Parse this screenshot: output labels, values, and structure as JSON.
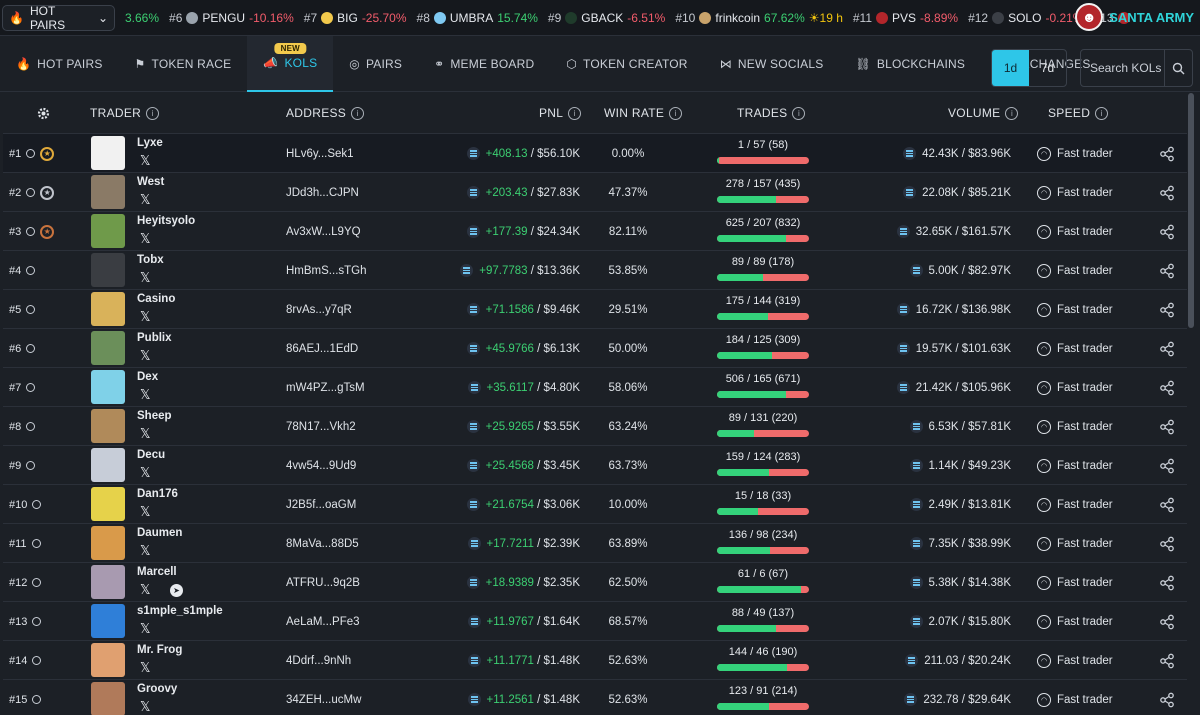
{
  "ticker": {
    "selector_label": "HOT PAIRS",
    "lead_change": "3.66%",
    "items": [
      {
        "rank": "#6",
        "name": "PENGU",
        "change": "-10.16%",
        "dir": "neg",
        "color": "#9aa3ad"
      },
      {
        "rank": "#7",
        "name": "BIG",
        "change": "-25.70%",
        "dir": "neg",
        "color": "#f2c94c"
      },
      {
        "rank": "#8",
        "name": "UMBRA",
        "change": "15.74%",
        "dir": "pos",
        "color": "#7fc9f2"
      },
      {
        "rank": "#9",
        "name": "GBACK",
        "change": "-6.51%",
        "dir": "neg",
        "color": "#1f3b2b"
      },
      {
        "rank": "#10",
        "name": "frinkcoin",
        "change": "67.62%",
        "dir": "pos",
        "color": "#c9a36b",
        "extra": "19 h"
      },
      {
        "rank": "#11",
        "name": "PVS",
        "change": "-8.89%",
        "dir": "neg",
        "color": "#b3262b"
      },
      {
        "rank": "#12",
        "name": "SOLO",
        "change": "-0.21%",
        "dir": "neg",
        "color": "#3b3f46"
      },
      {
        "rank": "#13",
        "name": "",
        "change": "",
        "dir": "neg",
        "color": "#b3262b"
      }
    ],
    "brand": "SANTA ARMY"
  },
  "nav": {
    "tabs": [
      {
        "label": "HOT PAIRS",
        "icon": "flame-icon",
        "glyph": "🔥",
        "active": false
      },
      {
        "label": "TOKEN RACE",
        "icon": "flag-icon",
        "glyph": "⚑",
        "active": false
      },
      {
        "label": "KOLS",
        "icon": "megaphone-icon",
        "glyph": "📣",
        "active": true,
        "badge": "NEW"
      },
      {
        "label": "PAIRS",
        "icon": "pairs-icon",
        "glyph": "◎",
        "active": false
      },
      {
        "label": "MEME BOARD",
        "icon": "binoculars-icon",
        "glyph": "⚭",
        "active": false
      },
      {
        "label": "TOKEN CREATOR",
        "icon": "token-creator-icon",
        "glyph": "⬡",
        "active": false
      },
      {
        "label": "NEW SOCIALS",
        "icon": "share-icon",
        "glyph": "⋈",
        "active": false
      },
      {
        "label": "BLOCKCHAINS",
        "icon": "link-icon",
        "glyph": "⛓",
        "active": false
      },
      {
        "label": "EXCHANGES",
        "icon": "exchange-icon",
        "glyph": "⇄",
        "active": false
      }
    ],
    "period_options": [
      "1d",
      "7d"
    ],
    "period_selected": "1d",
    "search_placeholder": "Search KOLs"
  },
  "table": {
    "headers": {
      "trader": "TRADER",
      "address": "ADDRESS",
      "pnl": "PNL",
      "win_rate": "WIN RATE",
      "trades": "TRADES",
      "volume": "VOLUME",
      "speed": "SPEED"
    },
    "rows": [
      {
        "rank": "#1",
        "medal": "gold",
        "name": "Lyxe",
        "avatar_color": "#f1f1f1",
        "address": "HLv6y...Sek1",
        "pnl_sol": "+408.13",
        "pnl_usd": "/ $56.10K",
        "win_rate": "0.00%",
        "trades": "1 / 57 (58)",
        "buy_frac": 0.02,
        "vol_sol": "42.43K",
        "vol_usd": "/ $83.96K",
        "speed": "Fast trader",
        "telegram": false
      },
      {
        "rank": "#2",
        "medal": "silver",
        "name": "West",
        "avatar_color": "#8a7a66",
        "address": "JDd3h...CJPN",
        "pnl_sol": "+203.43",
        "pnl_usd": "/ $27.83K",
        "win_rate": "47.37%",
        "trades": "278 / 157 (435)",
        "buy_frac": 0.64,
        "vol_sol": "22.08K",
        "vol_usd": "/ $85.21K",
        "speed": "Fast trader",
        "telegram": false
      },
      {
        "rank": "#3",
        "medal": "bronze",
        "name": "Heyitsyolo",
        "avatar_color": "#6f9a4a",
        "address": "Av3xW...L9YQ",
        "pnl_sol": "+177.39",
        "pnl_usd": "/ $24.34K",
        "win_rate": "82.11%",
        "trades": "625 / 207 (832)",
        "buy_frac": 0.75,
        "vol_sol": "32.65K",
        "vol_usd": "/ $161.57K",
        "speed": "Fast trader",
        "telegram": false
      },
      {
        "rank": "#4",
        "medal": "",
        "name": "Tobx",
        "avatar_color": "#3a3d42",
        "address": "HmBmS...sTGh",
        "pnl_sol": "+97.7783",
        "pnl_usd": "/ $13.36K",
        "win_rate": "53.85%",
        "trades": "89 / 89 (178)",
        "buy_frac": 0.5,
        "vol_sol": "5.00K",
        "vol_usd": "/ $82.97K",
        "speed": "Fast trader",
        "telegram": false
      },
      {
        "rank": "#5",
        "medal": "",
        "name": "Casino",
        "avatar_color": "#d9b25a",
        "address": "8rvAs...y7qR",
        "pnl_sol": "+71.1586",
        "pnl_usd": "/ $9.46K",
        "win_rate": "29.51%",
        "trades": "175 / 144 (319)",
        "buy_frac": 0.55,
        "vol_sol": "16.72K",
        "vol_usd": "/ $136.98K",
        "speed": "Fast trader",
        "telegram": false
      },
      {
        "rank": "#6",
        "medal": "",
        "name": "Publix",
        "avatar_color": "#6b8f5a",
        "address": "86AEJ...1EdD",
        "pnl_sol": "+45.9766",
        "pnl_usd": "/ $6.13K",
        "win_rate": "50.00%",
        "trades": "184 / 125 (309)",
        "buy_frac": 0.6,
        "vol_sol": "19.57K",
        "vol_usd": "/ $101.63K",
        "speed": "Fast trader",
        "telegram": false
      },
      {
        "rank": "#7",
        "medal": "",
        "name": "Dex",
        "avatar_color": "#7fd1e8",
        "address": "mW4PZ...gTsM",
        "pnl_sol": "+35.6117",
        "pnl_usd": "/ $4.80K",
        "win_rate": "58.06%",
        "trades": "506 / 165 (671)",
        "buy_frac": 0.75,
        "vol_sol": "21.42K",
        "vol_usd": "/ $105.96K",
        "speed": "Fast trader",
        "telegram": false
      },
      {
        "rank": "#8",
        "medal": "",
        "name": "Sheep",
        "avatar_color": "#b08a5a",
        "address": "78N17...Vkh2",
        "pnl_sol": "+25.9265",
        "pnl_usd": "/ $3.55K",
        "win_rate": "63.24%",
        "trades": "89 / 131 (220)",
        "buy_frac": 0.4,
        "vol_sol": "6.53K",
        "vol_usd": "/ $57.81K",
        "speed": "Fast trader",
        "telegram": false
      },
      {
        "rank": "#9",
        "medal": "",
        "name": "Decu",
        "avatar_color": "#c7cdd8",
        "address": "4vw54...9Ud9",
        "pnl_sol": "+25.4568",
        "pnl_usd": "/ $3.45K",
        "win_rate": "63.73%",
        "trades": "159 / 124 (283)",
        "buy_frac": 0.56,
        "vol_sol": "1.14K",
        "vol_usd": "/ $49.23K",
        "speed": "Fast trader",
        "telegram": false
      },
      {
        "rank": "#10",
        "medal": "",
        "name": "Dan176",
        "avatar_color": "#e6d24a",
        "address": "J2B5f...oaGM",
        "pnl_sol": "+21.6754",
        "pnl_usd": "/ $3.06K",
        "win_rate": "10.00%",
        "trades": "15 / 18 (33)",
        "buy_frac": 0.45,
        "vol_sol": "2.49K",
        "vol_usd": "/ $13.81K",
        "speed": "Fast trader",
        "telegram": false
      },
      {
        "rank": "#11",
        "medal": "",
        "name": "Daumen",
        "avatar_color": "#d99a4a",
        "address": "8MaVa...88D5",
        "pnl_sol": "+17.7211",
        "pnl_usd": "/ $2.39K",
        "win_rate": "63.89%",
        "trades": "136 / 98 (234)",
        "buy_frac": 0.58,
        "vol_sol": "7.35K",
        "vol_usd": "/ $38.99K",
        "speed": "Fast trader",
        "telegram": false
      },
      {
        "rank": "#12",
        "medal": "",
        "name": "Marcell",
        "avatar_color": "#a89ab0",
        "address": "ATFRU...9q2B",
        "pnl_sol": "+18.9389",
        "pnl_usd": "/ $2.35K",
        "win_rate": "62.50%",
        "trades": "61 / 6 (67)",
        "buy_frac": 0.91,
        "vol_sol": "5.38K",
        "vol_usd": "/ $14.38K",
        "speed": "Fast trader",
        "telegram": true
      },
      {
        "rank": "#13",
        "medal": "",
        "name": "s1mple_s1mple",
        "avatar_color": "#2f7fd8",
        "address": "AeLaM...PFe3",
        "pnl_sol": "+11.9767",
        "pnl_usd": "/ $1.64K",
        "win_rate": "68.57%",
        "trades": "88 / 49 (137)",
        "buy_frac": 0.64,
        "vol_sol": "2.07K",
        "vol_usd": "/ $15.80K",
        "speed": "Fast trader",
        "telegram": false
      },
      {
        "rank": "#14",
        "medal": "",
        "name": "Mr. Frog",
        "avatar_color": "#e0a070",
        "address": "4Ddrf...9nNh",
        "pnl_sol": "+11.1771",
        "pnl_usd": "/ $1.48K",
        "win_rate": "52.63%",
        "trades": "144 / 46 (190)",
        "buy_frac": 0.76,
        "vol_sol": "211.03",
        "vol_usd": "/ $20.24K",
        "speed": "Fast trader",
        "telegram": false
      },
      {
        "rank": "#15",
        "medal": "",
        "name": "Groovy",
        "avatar_color": "#b07a5a",
        "address": "34ZEH...ucMw",
        "pnl_sol": "+11.2561",
        "pnl_usd": "/ $1.48K",
        "win_rate": "52.63%",
        "trades": "123 / 91 (214)",
        "buy_frac": 0.57,
        "vol_sol": "232.78",
        "vol_usd": "/ $29.64K",
        "speed": "Fast trader",
        "telegram": false
      }
    ]
  },
  "colors": {
    "accent": "#2ec6e8",
    "positive": "#3ccf72",
    "negative": "#f25c6b",
    "gold": "#e0a93a",
    "silver": "#c0c4cc",
    "bronze": "#c9733d"
  }
}
